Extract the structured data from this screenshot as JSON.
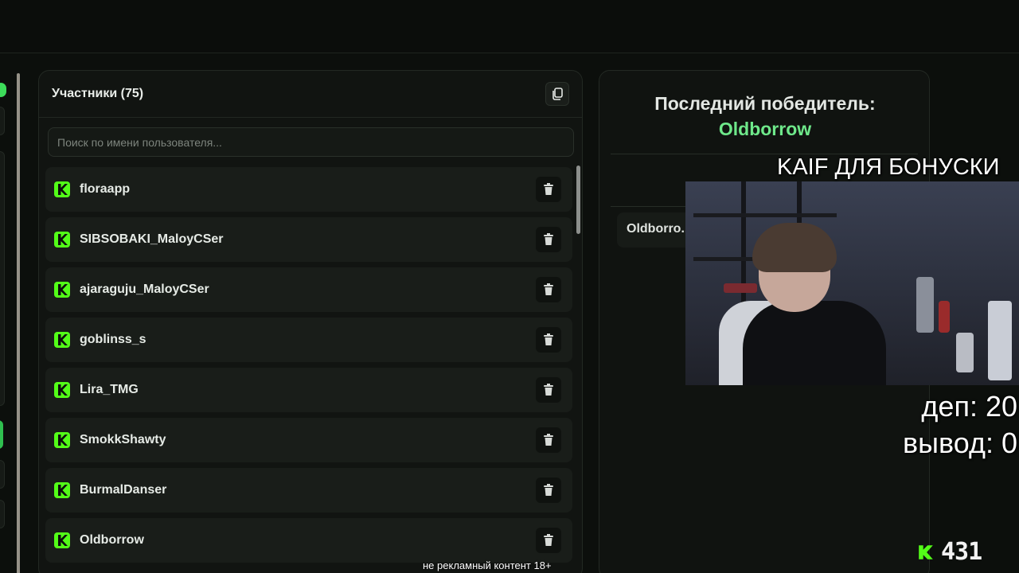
{
  "participants": {
    "title": "Участники (75)",
    "search_placeholder": "Поиск по имени пользователя...",
    "items": [
      {
        "name": "floraapp"
      },
      {
        "name": "SIBSOBAKI_MaloyCSer"
      },
      {
        "name": "ajaraguju_MaloyCSer"
      },
      {
        "name": "goblinss_s"
      },
      {
        "name": "Lira_TMG"
      },
      {
        "name": "SmokkShawty"
      },
      {
        "name": "BurmalDanser"
      },
      {
        "name": "Oldborrow"
      }
    ]
  },
  "winner": {
    "title": "Последний победитель:",
    "name": "Oldborrow",
    "history_item": "Oldborro..."
  },
  "overlay": {
    "cam_label": "KAIF ДЛЯ БОНУСКИ",
    "dep": "деп: 20",
    "withdraw": "вывод: 0",
    "count": "431",
    "disclaimer": "не рекламный контент 18+"
  },
  "colors": {
    "accent": "#53fc18",
    "winner": "#6ee88a",
    "background": "#0c0f0c"
  },
  "icons": {
    "platform": "kick-logo-icon",
    "copy": "copy-icon",
    "delete": "trash-icon"
  }
}
